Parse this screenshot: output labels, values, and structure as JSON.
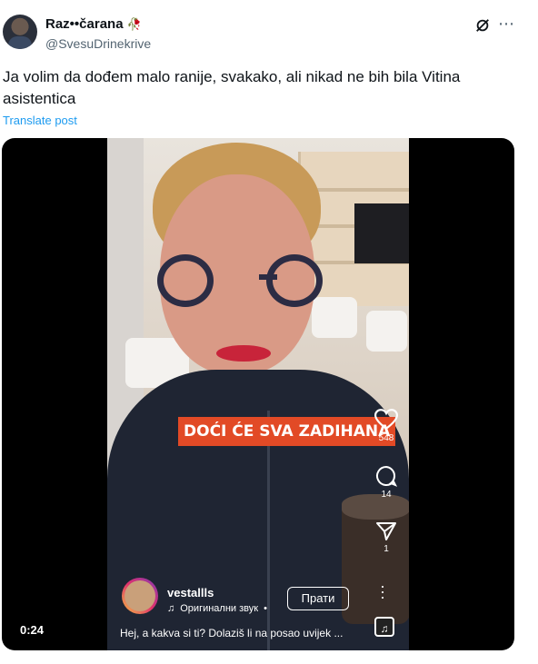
{
  "author": {
    "display_name": "Raz••čarana",
    "emoji": "🥀",
    "handle": "@SvesuDrinekrive"
  },
  "post": {
    "text": "Ja volim da dođem malo ranije, svakako, ali nikad ne bih bila Vitina asistentica",
    "translate_label": "Translate post"
  },
  "video": {
    "timestamp": "0:24",
    "caption_overlay": "DOĆI ĆE SVA ZADIHANA",
    "likes": "548",
    "comments": "14",
    "shares": "1",
    "ig_username": "vestallls",
    "ig_audio": "Оригинални звук",
    "ig_audio_dot": "•",
    "follow_label": "Прати",
    "ig_caption": "Hej, a kakva si ti? Dolaziš li na posao uvijek ..."
  },
  "icons": {
    "grok": "grok-icon",
    "more": "more-icon",
    "heart": "heart-icon",
    "comment": "comment-icon",
    "share": "share-icon",
    "music": "music-note-icon"
  }
}
